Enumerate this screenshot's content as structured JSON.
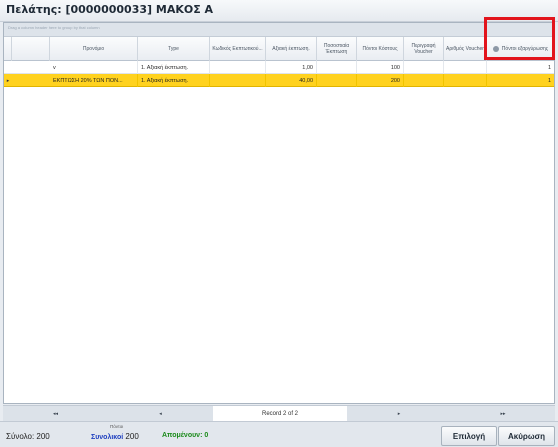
{
  "window": {
    "title": "Πελάτης: [0000000033] ΜΑΚΟΣ Α"
  },
  "grid": {
    "group_panel_hint": "Drag a column header here to group by that column",
    "columns": [
      {
        "label": "Προνόμιο"
      },
      {
        "label": "Type"
      },
      {
        "label": "Κωδικός Εκπτωτικού..."
      },
      {
        "label": "Αξιακή έκπτωση."
      },
      {
        "label": "Ποσοστιαία Έκπτωση"
      },
      {
        "label": "Πόντοι Κόστους"
      },
      {
        "label": "Περιγραφή Voucher"
      },
      {
        "label": "Αριθμός Voucher"
      },
      {
        "label": "Πόντοι εξαργύρωσης",
        "icon": "circle-icon"
      }
    ],
    "rows": [
      {
        "indicator": "",
        "cells": [
          "v",
          "1. Αξιακή έκπτωση.",
          "",
          "1,00",
          "",
          "100",
          "",
          "",
          "1"
        ]
      },
      {
        "indicator": "▸",
        "cells": [
          "ΕΚΠΤΩΣΗ 20% ΤΩΝ ΠΟΝ...",
          "1. Αξιακή έκπτωση.",
          "",
          "40,00",
          "",
          "200",
          "",
          "",
          "1"
        ]
      }
    ],
    "selected_row_color": "#ffd21f"
  },
  "navigator": {
    "first": "◂◂",
    "prev": "◂",
    "record": "Record 2 of 2",
    "next": "▸",
    "last": "▸▸"
  },
  "status": {
    "total_label": "Σύνολο: 200",
    "points_caption": "Πόντοι",
    "total_points_label": "Συνολικοί",
    "total_points_value": "200",
    "remaining_label": "Απομένουν: 0",
    "remaining_color": "#1a8a1a",
    "total_points_color": "#1e3fbf"
  },
  "buttons": {
    "select": "Επιλογή",
    "cancel": "Ακύρωση"
  },
  "highlight_color": "#e2141c"
}
